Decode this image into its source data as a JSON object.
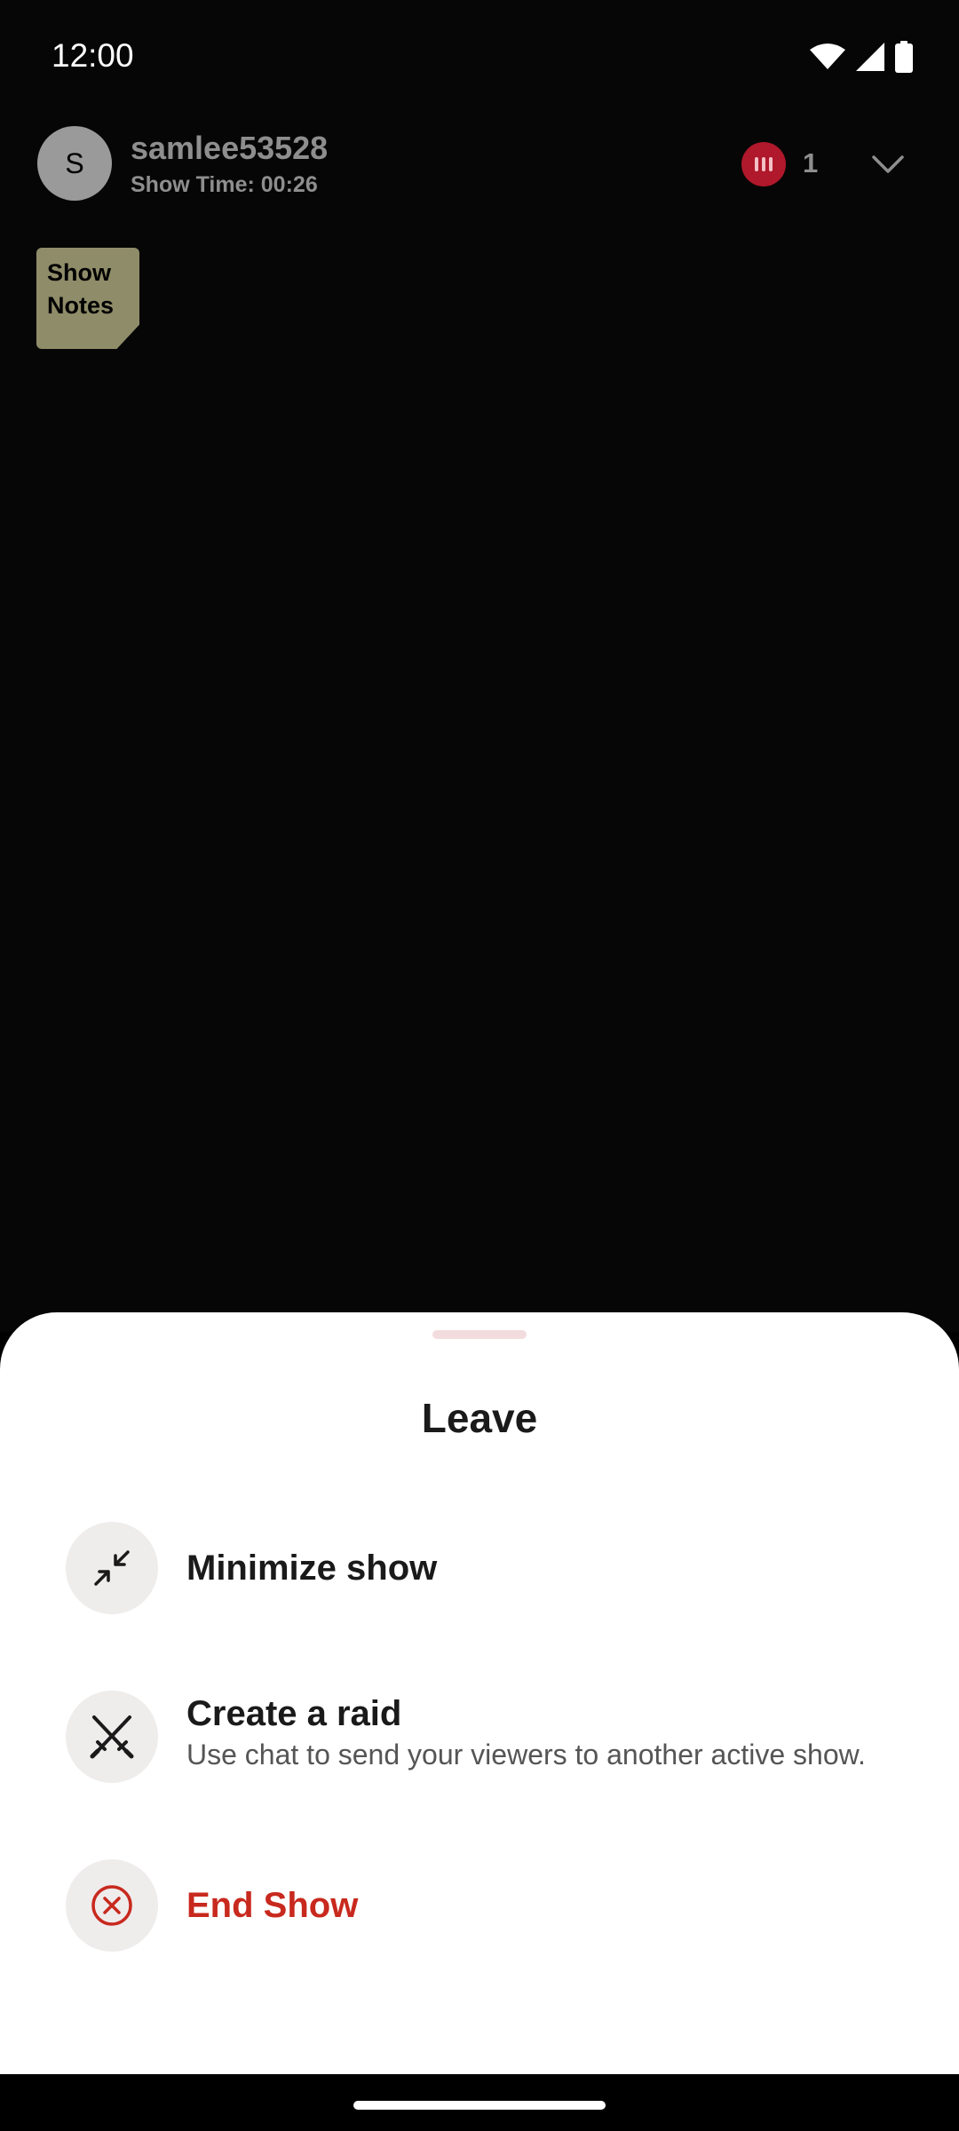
{
  "status_bar": {
    "time": "12:00"
  },
  "host": {
    "avatar_initial": "S",
    "username": "samlee53528",
    "show_time": "Show Time: 00:26",
    "viewer_count": "1"
  },
  "show_notes": {
    "label": "Show Notes"
  },
  "leave_sheet": {
    "title": "Leave",
    "options": [
      {
        "label": "Minimize show",
        "icon": "minimize-icon"
      },
      {
        "label": "Create a raid",
        "subtitle": "Use chat to send your viewers to another active show.",
        "icon": "crossed-swords-icon"
      },
      {
        "label": "End Show",
        "icon": "close-circle-icon"
      }
    ]
  },
  "colors": {
    "danger": "#c8291e",
    "viewer_badge": "#b0182b",
    "show_notes_bg": "#8f8c69"
  }
}
